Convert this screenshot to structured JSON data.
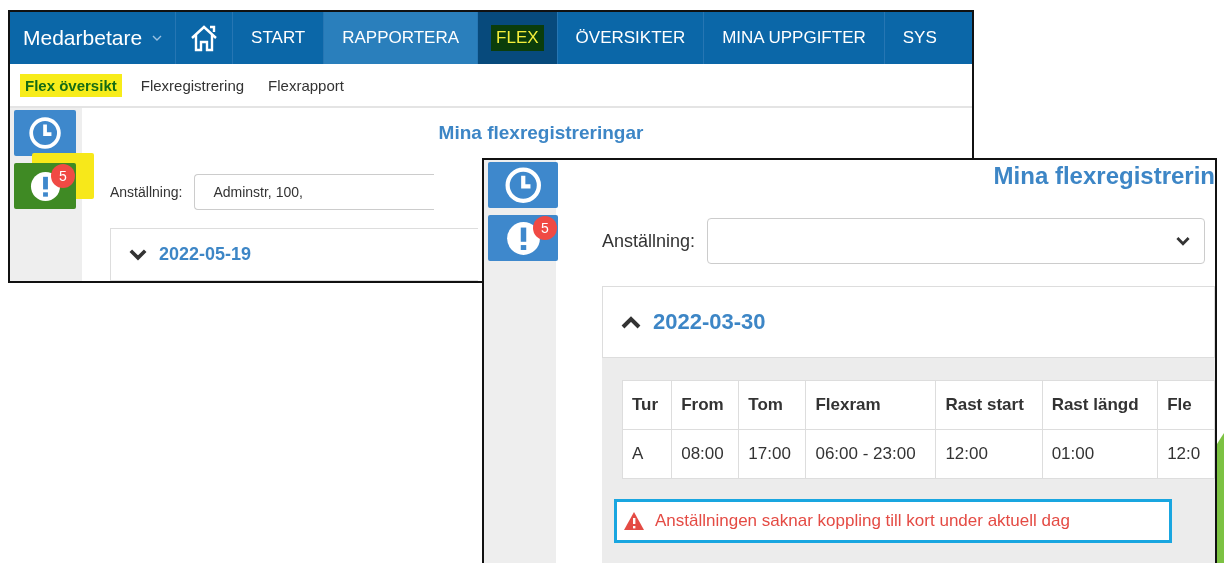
{
  "screenshots": [
    {
      "nav": {
        "menu": "Medarbetare",
        "tabs": [
          {
            "label": "START",
            "selected": false,
            "hovered": false,
            "highlighted": false
          },
          {
            "label": "RAPPORTERA",
            "selected": false,
            "hovered": true,
            "highlighted": false
          },
          {
            "label": "FLEX",
            "selected": true,
            "hovered": false,
            "highlighted": true
          },
          {
            "label": "ÖVERSIKTER",
            "selected": false,
            "hovered": false,
            "highlighted": false
          },
          {
            "label": "MINA UPPGIFTER",
            "selected": false,
            "hovered": false,
            "highlighted": false
          },
          {
            "label": "SYS",
            "selected": false,
            "hovered": false,
            "highlighted": false
          }
        ]
      },
      "subnav": [
        {
          "label": "Flex översikt",
          "selected": true,
          "highlighted": true
        },
        {
          "label": "Flexregistrering",
          "selected": false,
          "highlighted": false
        },
        {
          "label": "Flexrapport",
          "selected": false,
          "highlighted": false
        }
      ],
      "sidebar": [
        {
          "kind": "clock",
          "highlighted": false
        },
        {
          "kind": "alert",
          "badge": "5",
          "highlighted": true
        }
      ],
      "title": "Mina flexregistreringar",
      "employment": {
        "label": "Anställning:",
        "value": "Adminstr, 100,"
      },
      "section": {
        "date": "2022-05-19",
        "expanded": false
      }
    },
    {
      "sidebar": [
        {
          "kind": "clock",
          "highlighted": false
        },
        {
          "kind": "alert",
          "badge": "5",
          "highlighted": false
        }
      ],
      "title": "Mina flexregistrerin",
      "employment": {
        "label": "Anställning:"
      },
      "section": {
        "date": "2022-03-30",
        "expanded": true,
        "table": {
          "columns": [
            "Tur",
            "From",
            "Tom",
            "Flexram",
            "Rast start",
            "Rast längd",
            "Fle"
          ],
          "rows": [
            [
              "A",
              "08:00",
              "17:00",
              "06:00 - 23:00",
              "12:00",
              "01:00",
              "12:0"
            ]
          ]
        },
        "warning": "Anställningen saknar koppling till kort under aktuell dag"
      }
    }
  ]
}
